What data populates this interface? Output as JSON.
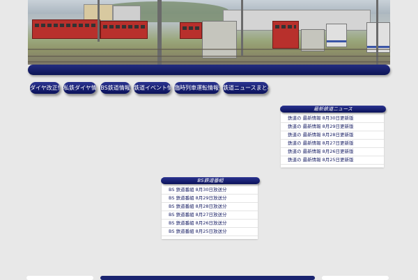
{
  "banner": {
    "alt": "Railway depot with red diesel railcars"
  },
  "nav_menu": [
    {
      "label": "ダイヤ改正情報"
    },
    {
      "label": "私鉄ダイヤ情報"
    },
    {
      "label": "BS鉄道情報"
    },
    {
      "label": "鉄道イベント情報"
    },
    {
      "label": "臨時列車運転情報一覧"
    },
    {
      "label": "鉄道ニュースまとめ一覧"
    }
  ],
  "widget_right": {
    "title": "最新鉄道ニュース",
    "items": [
      "鉄道の 最新情報 8月30日更新版",
      "鉄道の 最新情報 8月29日更新版",
      "鉄道の 最新情報 8月28日更新版",
      "鉄道の 最新情報 8月27日更新版",
      "鉄道の 最新情報 8月26日更新版",
      "鉄道の 最新情報 8月25日更新版"
    ]
  },
  "widget_center": {
    "title": "BS鉄道番組",
    "items": [
      "BS 鉄道番組 8月30日放送分",
      "BS 鉄道番組 8月29日放送分",
      "BS 鉄道番組 8月28日放送分",
      "BS 鉄道番組 8月27日放送分",
      "BS 鉄道番組 8月26日放送分",
      "BS 鉄道番組 8月25日放送分"
    ]
  },
  "colors": {
    "accent": "#0c1455",
    "background": "#e8e8e8",
    "link": "#1a2066"
  }
}
